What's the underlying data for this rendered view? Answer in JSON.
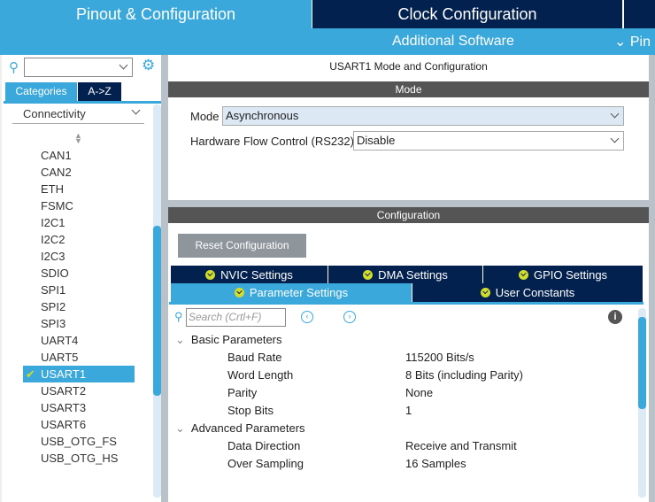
{
  "header": {
    "tabs": [
      "Pinout & Configuration",
      "Clock Configuration"
    ],
    "sub_tabs": [
      "Additional Software",
      "Pin"
    ]
  },
  "sidebar": {
    "search_value": "",
    "tabs": [
      "Categories",
      "A->Z"
    ],
    "category": "Connectivity",
    "items": [
      "CAN1",
      "CAN2",
      "ETH",
      "FSMC",
      "I2C1",
      "I2C2",
      "I2C3",
      "SDIO",
      "SPI1",
      "SPI2",
      "SPI3",
      "UART4",
      "UART5",
      "USART1",
      "USART2",
      "USART3",
      "USART6",
      "USB_OTG_FS",
      "USB_OTG_HS"
    ],
    "selected": "USART1"
  },
  "main": {
    "title": "USART1 Mode and Configuration",
    "mode_header": "Mode",
    "mode_label": "Mode",
    "mode_value": "Asynchronous",
    "hw_label": "Hardware Flow Control (RS232)",
    "hw_value": "Disable",
    "config_header": "Configuration",
    "reset_label": "Reset Configuration",
    "tabs_row1": [
      "NVIC Settings",
      "DMA Settings",
      "GPIO Settings"
    ],
    "tabs_row2": [
      "Parameter Settings",
      "User Constants"
    ],
    "search_placeholder": "Search (Crtl+F)",
    "groups": [
      {
        "name": "Basic Parameters",
        "params": [
          {
            "k": "Baud Rate",
            "v": "115200 Bits/s"
          },
          {
            "k": "Word Length",
            "v": "8 Bits (including Parity)"
          },
          {
            "k": "Parity",
            "v": "None"
          },
          {
            "k": "Stop Bits",
            "v": "1"
          }
        ]
      },
      {
        "name": "Advanced Parameters",
        "params": [
          {
            "k": "Data Direction",
            "v": "Receive and Transmit"
          },
          {
            "k": "Over Sampling",
            "v": "16 Samples"
          }
        ]
      }
    ]
  },
  "colors": {
    "blue": "#3ba8dc",
    "navy": "#03214f",
    "grey": "#555555"
  }
}
